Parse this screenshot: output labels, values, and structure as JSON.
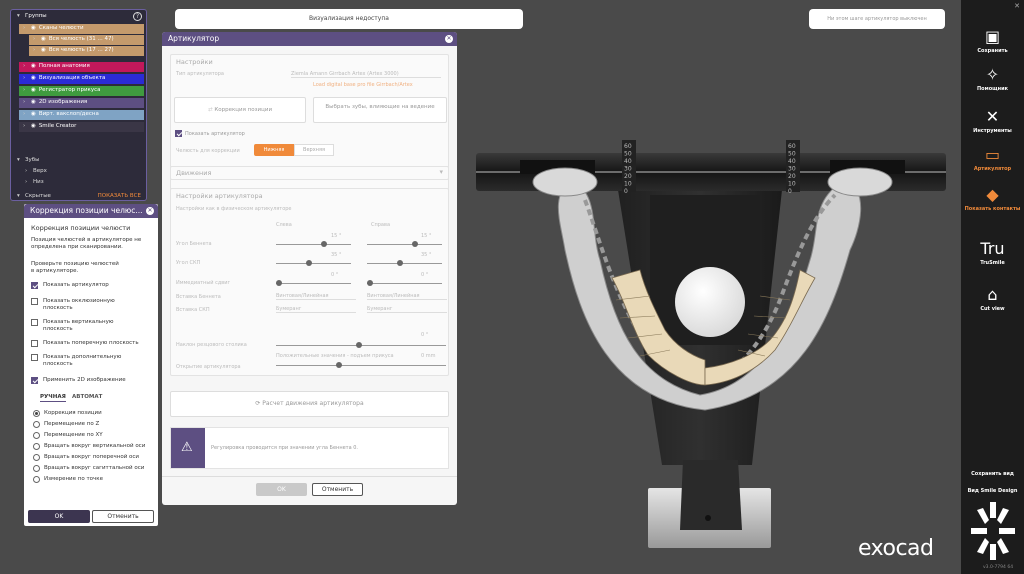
{
  "top_bar": {
    "title": "Визуализация недоступа",
    "hint": "Ни этом шаге артикулятор выключен"
  },
  "groups": {
    "title": "Группы",
    "items": [
      {
        "label": "Сканы челюсти",
        "color": "#c49a6c"
      },
      {
        "label": "Вся челюсть (31 ... 47)",
        "color": "#c49a6c"
      },
      {
        "label": "Вся челюсть (17 ... 27)",
        "color": "#c49a6c"
      },
      {
        "label": "Полная анатомия",
        "color": "#c2185b"
      },
      {
        "label": "Визуализация объекта",
        "color": "#2b2bd6"
      },
      {
        "label": "Регистратор прикуса",
        "color": "#3f9b3f"
      },
      {
        "label": "2D изображения",
        "color": "#5d4f82"
      },
      {
        "label": "Вирт. вакслоп/десна",
        "color": "#7fa3c4"
      },
      {
        "label": "Smile Creator",
        "color": "#3a3646"
      }
    ],
    "teeth_header": "Зубы",
    "teeth": [
      "Верх",
      "Низ"
    ],
    "hidden": "Скрытые",
    "show_all": "ПОКАЗАТЬ ВСЕ"
  },
  "correction": {
    "title": "Коррекция позиции челюс...",
    "subtitle": "Коррекция позиции челюсти",
    "intro": "Позиция челюстей в артикуляторе не определена при сканировании.",
    "check_hint": "Проверьте позицию челюстей в артикуляторе.",
    "checks": [
      {
        "label": "Показать артикулятор",
        "on": true
      },
      {
        "label": "Показать окклюзионную плоскость",
        "on": false
      },
      {
        "label": "Показать вертикальную плоскость",
        "on": false
      },
      {
        "label": "Показать поперечную плоскость",
        "on": false
      },
      {
        "label": "Показать дополнительную плоскость",
        "on": false
      },
      {
        "label": "Применить 2D изображение",
        "on": true
      }
    ],
    "tab_manual": "РУЧНАЯ",
    "tab_auto": "АВТОМАТ",
    "radios": [
      {
        "label": "Коррекция позиции",
        "on": true
      },
      {
        "label": "Перемещение по Z",
        "on": false
      },
      {
        "label": "Перемещение по XY",
        "on": false
      },
      {
        "label": "Вращать вокруг вертикальной оси",
        "on": false
      },
      {
        "label": "Вращать вокруг поперечной оси",
        "on": false
      },
      {
        "label": "Вращать вокруг сагиттальной оси",
        "on": false
      },
      {
        "label": "Измерение по точке",
        "on": false
      }
    ],
    "ok": "OK",
    "cancel": "Отменить"
  },
  "articulator": {
    "title": "Артикулятор",
    "settings_header": "Настройки",
    "articulator_type_label": "Тип артикулятора",
    "articulator_type_value": "Ziemla Amann Girrbach Artex (Artex 3000)",
    "model_link": "Load digital base pro file Girrbach/Artex",
    "btn_position": "Коррекция позиции",
    "btn_select_teeth": "Выбрать зубы, влияющие на ведение",
    "show_articulator": "Показать артикулятор",
    "occlusion_label": "Челюсть для коррекции",
    "seg_left": "Нижняя",
    "seg_right": "Верхняя",
    "movement_header": "Движения",
    "art_settings_header": "Настройки артикулятора",
    "art_settings_hint": "Настройки как в физическом артикуляторе",
    "col_left": "Слева",
    "col_right": "Справа",
    "row1": "Угол Беннета",
    "row2": "Угол СКП",
    "row3": "Иммедиатный сдвиг",
    "row4": "Вставка Беннета",
    "row5": "Вставка СКП",
    "v_left1": "15 °",
    "v_right1": "15 °",
    "v_left2": "35 °",
    "v_right2": "35 °",
    "v_left3": "0 °",
    "v_right3": "0 °",
    "sel_left4": "Винтовая/Линейная",
    "sel_right4": "Винтовая/Линейная",
    "sel_left5": "Бумеранг",
    "sel_right5": "Бумеранг",
    "pin_label": "Наклон резцового столика",
    "pin_value": "0 °",
    "opening_label": "Открытие артикулятора",
    "opening_hint": "Положительные значения - подъем прикуса",
    "opening_value": "0 mm",
    "calc_btn": "Расчет движения артикулятора",
    "warning": "Регулировка проводится при значении угла Беннета 0.",
    "ok": "OK",
    "cancel": "Отменить"
  },
  "toolbar": {
    "items": [
      {
        "label": "Сохранить",
        "icon": "save-icon",
        "glyph": "▣"
      },
      {
        "label": "Помощник",
        "icon": "wand-icon",
        "glyph": "✧"
      },
      {
        "label": "Инструменты",
        "icon": "tools-icon",
        "glyph": "✕"
      },
      {
        "label": "Артикулятор",
        "icon": "articulator-icon",
        "glyph": "▭"
      },
      {
        "label": "Показать контакты",
        "icon": "contacts-icon",
        "glyph": "◆"
      },
      {
        "label": "TruSmile",
        "icon": "trusmile-icon",
        "glyph": "Tru"
      },
      {
        "label": "Cut view",
        "icon": "cutview-icon",
        "glyph": "⌂"
      }
    ],
    "save_view": "Сохранить вид",
    "smile_design": "Вид Smile Design",
    "version": "v3.0-7794 64"
  },
  "scale_values": [
    "60",
    "50",
    "40",
    "30",
    "20",
    "10",
    "0"
  ],
  "brand": "exocad"
}
